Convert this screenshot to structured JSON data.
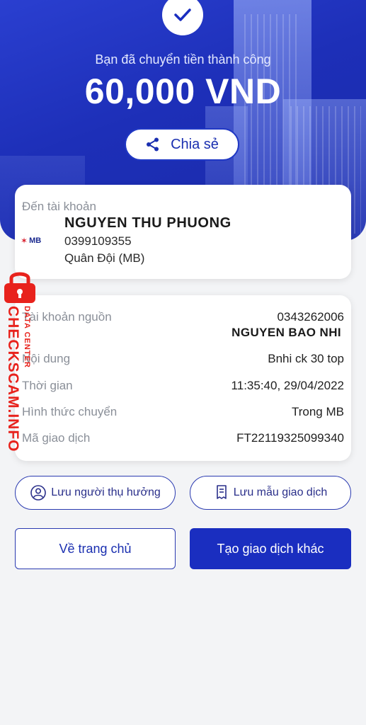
{
  "header": {
    "subtitle": "Bạn đã chuyển tiền thành công",
    "amount": "60,000 VND",
    "share_label": "Chia sẻ"
  },
  "recipient": {
    "label": "Đến tài khoản",
    "name": "NGUYEN THU PHUONG",
    "account": "0399109355",
    "bank": "Quân Đội (MB)",
    "bank_logo_text": "MB"
  },
  "details": {
    "source_label": "Tài khoản nguồn",
    "source_account": "0343262006",
    "source_name": "NGUYEN BAO NHI",
    "content_label": "Nội dung",
    "content_value": "Bnhi ck 30 top",
    "time_label": "Thời gian",
    "time_value": "11:35:40, 29/04/2022",
    "method_label": "Hình thức chuyển",
    "method_value": "Trong MB",
    "txn_label": "Mã giao dịch",
    "txn_value": "FT22119325099340"
  },
  "actions": {
    "save_recipient": "Lưu người thụ hưởng",
    "save_template": "Lưu mẫu giao dịch",
    "home": "Về trang chủ",
    "new_transaction": "Tạo giao dịch khác"
  },
  "watermark": {
    "main": "CHECKSCAM.INFO",
    "sub": "DATA CENTER"
  },
  "colors": {
    "primary": "#1a2ec0",
    "hero_bg": "#2038c4",
    "watermark": "#e8221c"
  }
}
